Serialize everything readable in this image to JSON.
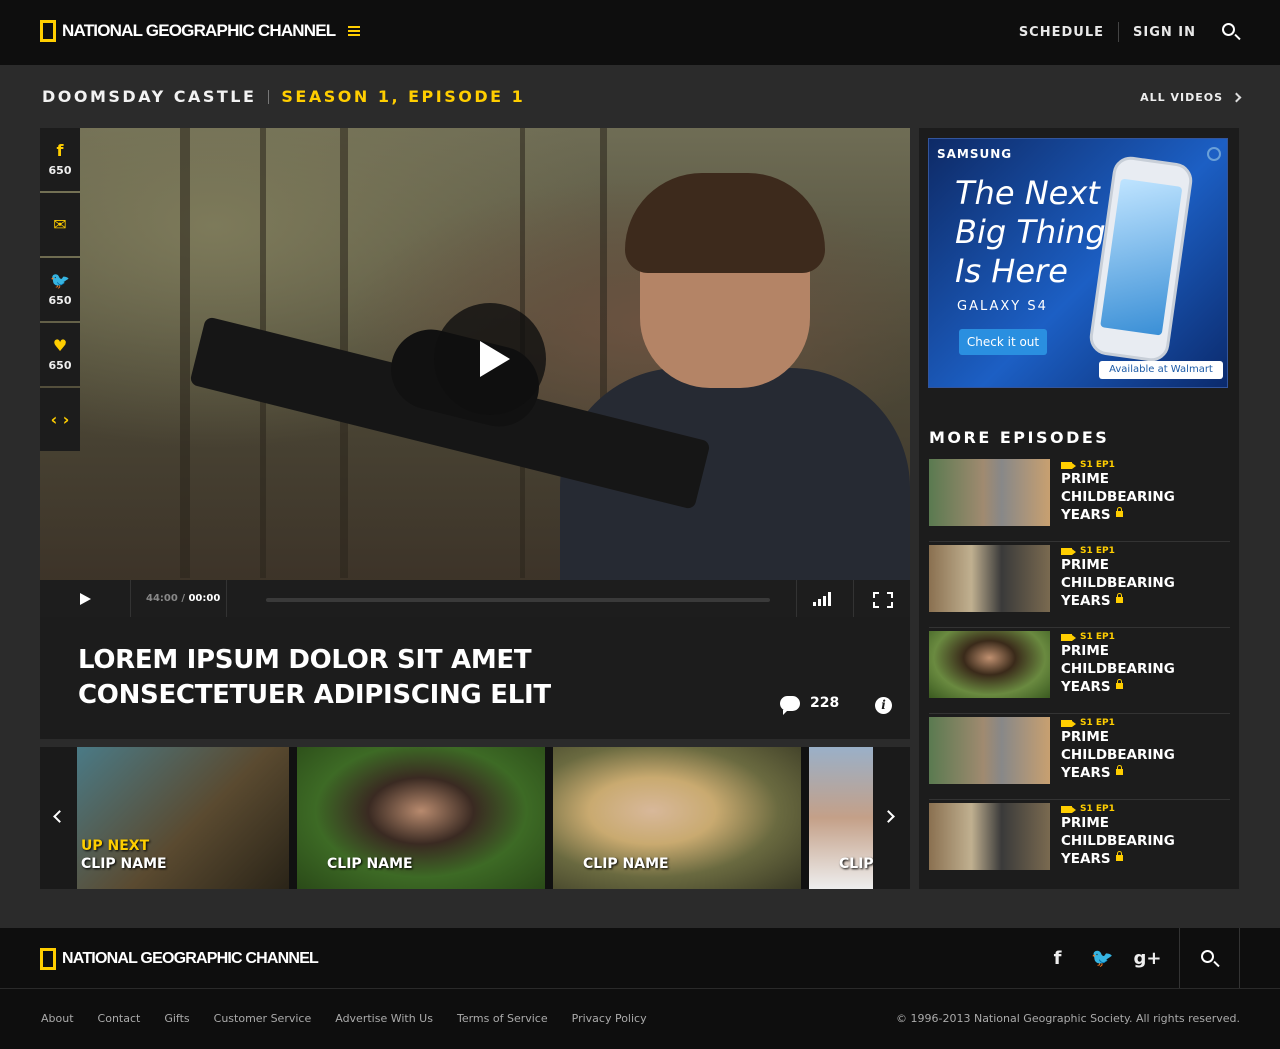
{
  "header": {
    "brand": "NATIONAL GEOGRAPHIC CHANNEL",
    "nav": [
      "SCHEDULE",
      "SIGN IN"
    ]
  },
  "breadcrumb": {
    "show": "DOOMSDAY CASTLE",
    "episode": "SEASON 1, EPISODE 1",
    "all_videos": "ALL VIDEOS"
  },
  "share": {
    "facebook_count": "650",
    "twitter_count": "650",
    "like_count": "650"
  },
  "player": {
    "duration": "44:00",
    "current": "00:00",
    "progress": 0
  },
  "video_info": {
    "title": "LOREM IPSUM DOLOR SIT AMET CONSECTETUER ADIPISCING ELIT",
    "comments": "228"
  },
  "clips": [
    {
      "label": "CLIP NAME",
      "up_next": "UP NEXT"
    },
    {
      "label": "CLIP NAME"
    },
    {
      "label": "CLIP NAME"
    },
    {
      "label": "CLIP"
    }
  ],
  "ad": {
    "brand": "SAMSUNG",
    "tagline": "The Next Big Thing Is Here",
    "model": "GALAXY S4",
    "cta": "Check it out",
    "retailer": "Available at Walmart"
  },
  "sidebar": {
    "title": "MORE EPISODES",
    "episodes": [
      {
        "meta": "S1 EP1",
        "title": "PRIME CHILDBEARING YEARS"
      },
      {
        "meta": "S1 EP1",
        "title": "PRIME CHILDBEARING YEARS"
      },
      {
        "meta": "S1 EP1",
        "title": "PRIME CHILDBEARING YEARS"
      },
      {
        "meta": "S1 EP1",
        "title": "PRIME CHILDBEARING YEARS"
      },
      {
        "meta": "S1 EP1",
        "title": "PRIME CHILDBEARING YEARS"
      }
    ]
  },
  "footer": {
    "brand": "NATIONAL GEOGRAPHIC CHANNEL",
    "links": [
      "About",
      "Contact",
      "Gifts",
      "Customer Service",
      "Advertise With Us",
      "Terms of Service",
      "Privacy Policy"
    ],
    "copyright": "© 1996-2013 National Geographic Society. All rights reserved."
  },
  "colors": {
    "accent": "#ffce00",
    "background": "#2b2b2b",
    "header": "#0e0e0e"
  }
}
